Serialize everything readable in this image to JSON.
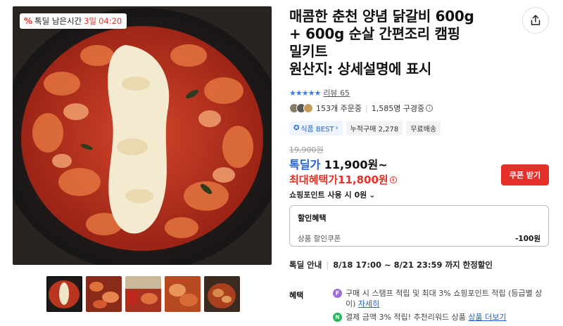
{
  "timer": {
    "label": "톡딜 남은시간",
    "days": "3일",
    "time": "04:20",
    "icon": "percent-icon"
  },
  "product": {
    "title_lines": [
      "매콤한 춘천 양념 닭갈비 600g",
      "+ 600g 순살 간편조리 캠핑",
      "밀키트",
      "원산지: 상세설명에 표시"
    ]
  },
  "rating": {
    "stars": "★★★★★",
    "reviews": "리뷰 65"
  },
  "buyers": {
    "ordering": "153개 주문중",
    "subscribers": "1,585명 구경중"
  },
  "tags": [
    "식품 BEST",
    "누적구매 2,278",
    "무료배송"
  ],
  "price": {
    "original": "19,900원",
    "deal_label": "톡딜가",
    "deal_value": "11,900원~",
    "max_label": "최대혜택가",
    "max_value": "11,800원",
    "coupon_button": "쿠폰 받기",
    "point_text": "쇼핑포인트 사용 시 0원"
  },
  "discount": {
    "header": "할인혜택",
    "row_label": "상품 할인쿠폰",
    "row_amount": "-100원"
  },
  "deal_info": {
    "label": "톡딜 안내",
    "period": "8/18 17:00 ~ 8/21 23:59 까지 한정할인"
  },
  "benefits": {
    "label": "혜택",
    "items": [
      {
        "icon": "F",
        "text": "구매 시 스탬프 적립 및 최대 3% 쇼핑포인트 적립 (등급별 상이)",
        "link": "자세히"
      },
      {
        "icon": "N",
        "text": "결제 금액 3% 적립! 추천리워드 상품",
        "link": "상품 더보기"
      }
    ]
  },
  "colors": {
    "accent_red": "#e8302a",
    "accent_blue": "#2261d6"
  }
}
